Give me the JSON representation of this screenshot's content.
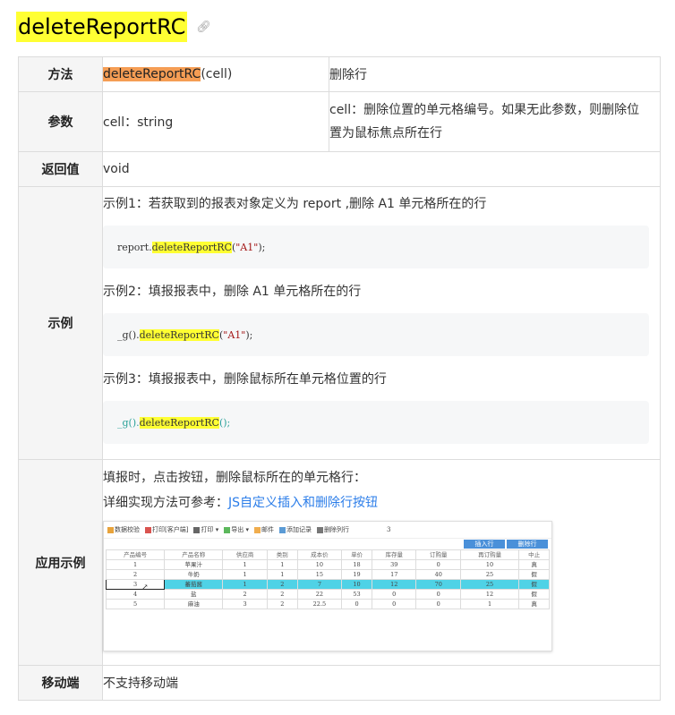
{
  "title": "deleteReportRC",
  "rows": {
    "method": {
      "label": "方法",
      "fn": "deleteReportRC",
      "params": "(cell)",
      "desc": "删除行"
    },
    "params": {
      "label": "参数",
      "value": "cell：string",
      "desc": "cell：删除位置的单元格编号。如果无此参数，则删除位置为鼠标焦点所在行"
    },
    "returns": {
      "label": "返回值",
      "value": "void"
    },
    "examples": {
      "label": "示例",
      "items": [
        {
          "text": "示例1：若获取到的报表对象定义为 report ,删除 A1 单元格所在的行",
          "pre": "report.",
          "fn": "deleteReportRC",
          "arg": "\"A1\"",
          "post": ");"
        },
        {
          "text": "示例2：填报报表中，删除 A1 单元格所在的行",
          "pre": "_g().",
          "fn": "deleteReportRC",
          "arg": "\"A1\"",
          "post": ");"
        },
        {
          "text": "示例3：填报报表中，删除鼠标所在单元格位置的行",
          "pre": "_g().",
          "fn": "deleteReportRC",
          "arg": "",
          "post": "();"
        }
      ]
    },
    "application": {
      "label": "应用示例",
      "line1": "填报时，点击按钮，删除鼠标所在的单元格行：",
      "line2_prefix": "详细实现方法可参考：",
      "line2_link": "JS自定义插入和删除行按钮",
      "screenshot": {
        "toolbar": [
          "数据校验",
          "打印[客户端]",
          "打印 ▾",
          "导出 ▾",
          "邮件",
          "添加记录",
          "删除列行",
          "3"
        ],
        "buttons": [
          "插入行",
          "删除行"
        ],
        "headers": [
          "产品编号",
          "产品名称",
          "供应商",
          "类别",
          "成本价",
          "单价",
          "库存量",
          "订购量",
          "再订购量",
          "中止"
        ],
        "rows": [
          [
            "1",
            "苹果汁",
            "1",
            "1",
            "10",
            "18",
            "39",
            "0",
            "10",
            "真"
          ],
          [
            "2",
            "牛奶",
            "1",
            "1",
            "15",
            "19",
            "17",
            "40",
            "25",
            "假"
          ],
          [
            "3",
            "蕃茄酱",
            "1",
            "2",
            "7",
            "10",
            "12",
            "70",
            "25",
            "假"
          ],
          [
            "4",
            "盐",
            "2",
            "2",
            "22",
            "53",
            "0",
            "0",
            "12",
            "假"
          ],
          [
            "5",
            "麻油",
            "3",
            "2",
            "22.5",
            "0",
            "0",
            "0",
            "1",
            "真"
          ]
        ]
      }
    },
    "mobile": {
      "label": "移动端",
      "value": "不支持移动端"
    }
  }
}
